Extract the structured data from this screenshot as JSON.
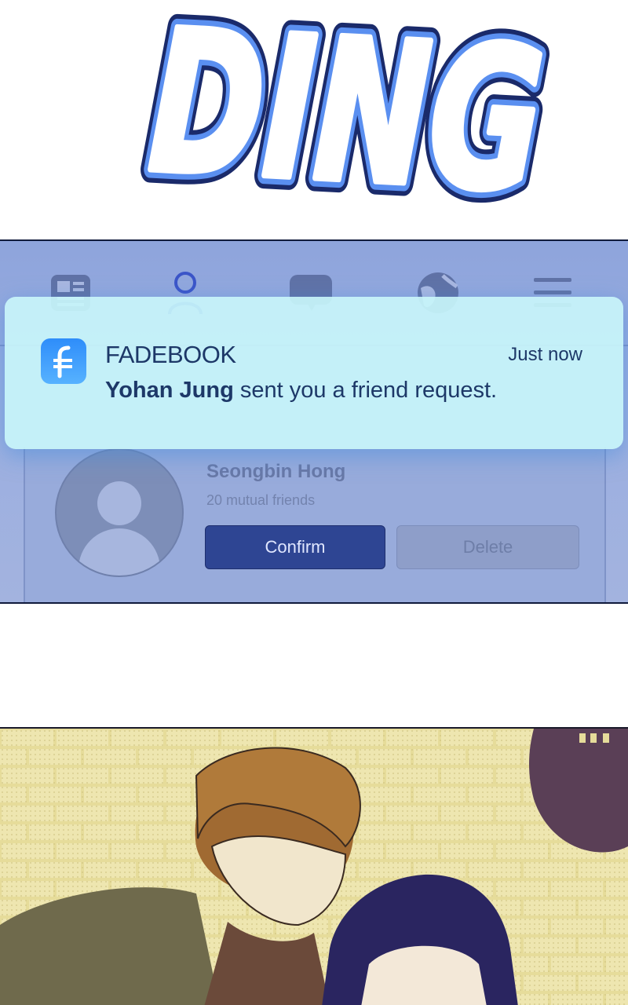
{
  "sfx": {
    "text": "DING"
  },
  "notification": {
    "app_name": "FADEBOOK",
    "time": "Just now",
    "sender": "Yohan Jung",
    "message": " sent you a friend request."
  },
  "friend_request": {
    "name": "Seongbin Hong",
    "mutual": "20 mutual friends",
    "confirm_label": "Confirm",
    "delete_label": "Delete"
  },
  "colors": {
    "notification_bg": "#c8f5fa",
    "app_icon": "#2e8dfa",
    "confirm_button": "#2e4593",
    "text_dark": "#1d3868"
  }
}
